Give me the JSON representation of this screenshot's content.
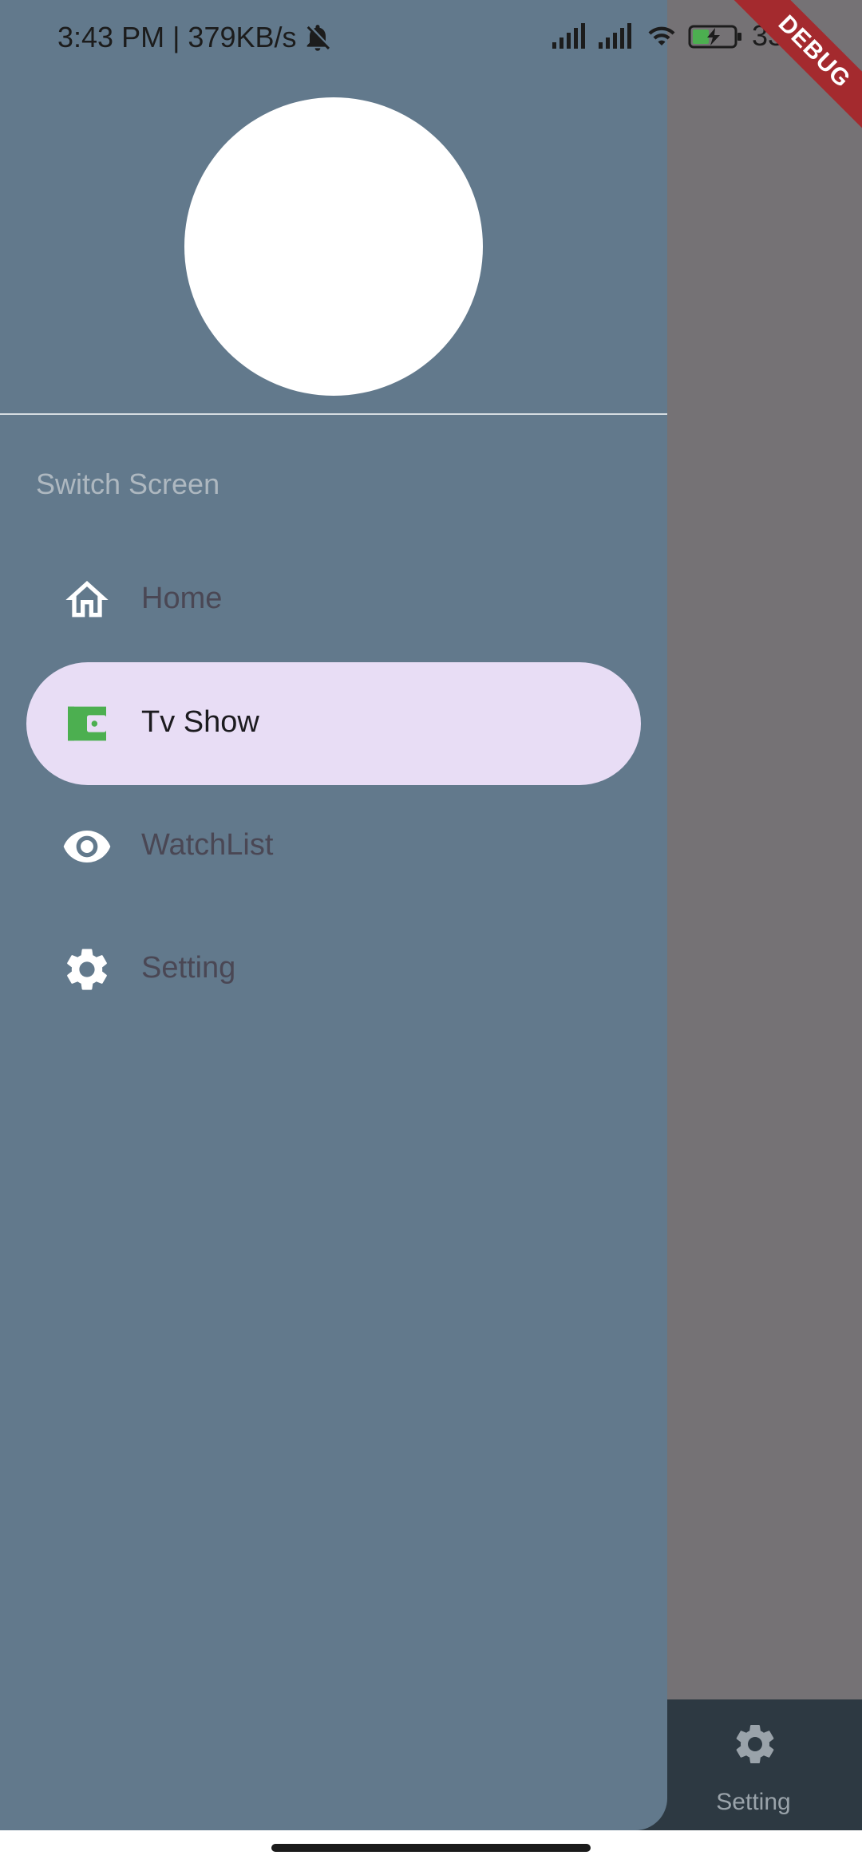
{
  "status_bar": {
    "time_speed": "3:43 PM | 379KB/s",
    "battery": "33"
  },
  "drawer": {
    "section_label": "Switch Screen",
    "items": [
      {
        "label": "Home",
        "icon": "home-icon",
        "selected": false
      },
      {
        "label": "Tv Show",
        "icon": "wallet-icon",
        "selected": true
      },
      {
        "label": "WatchList",
        "icon": "eye-icon",
        "selected": false
      },
      {
        "label": "Setting",
        "icon": "gear-icon",
        "selected": false
      }
    ]
  },
  "bottom_nav": {
    "visible_item_label": "Setting",
    "visible_item_icon": "gear-icon"
  },
  "debug_banner": "DEBUG",
  "colors": {
    "drawer_bg": "#62798c",
    "selected_pill": "#e8ddf5",
    "scrim": "#757275",
    "bottom_nav": "#2d3942",
    "wallet_icon": "#4caf50",
    "debug_banner": "#a42a2e"
  }
}
